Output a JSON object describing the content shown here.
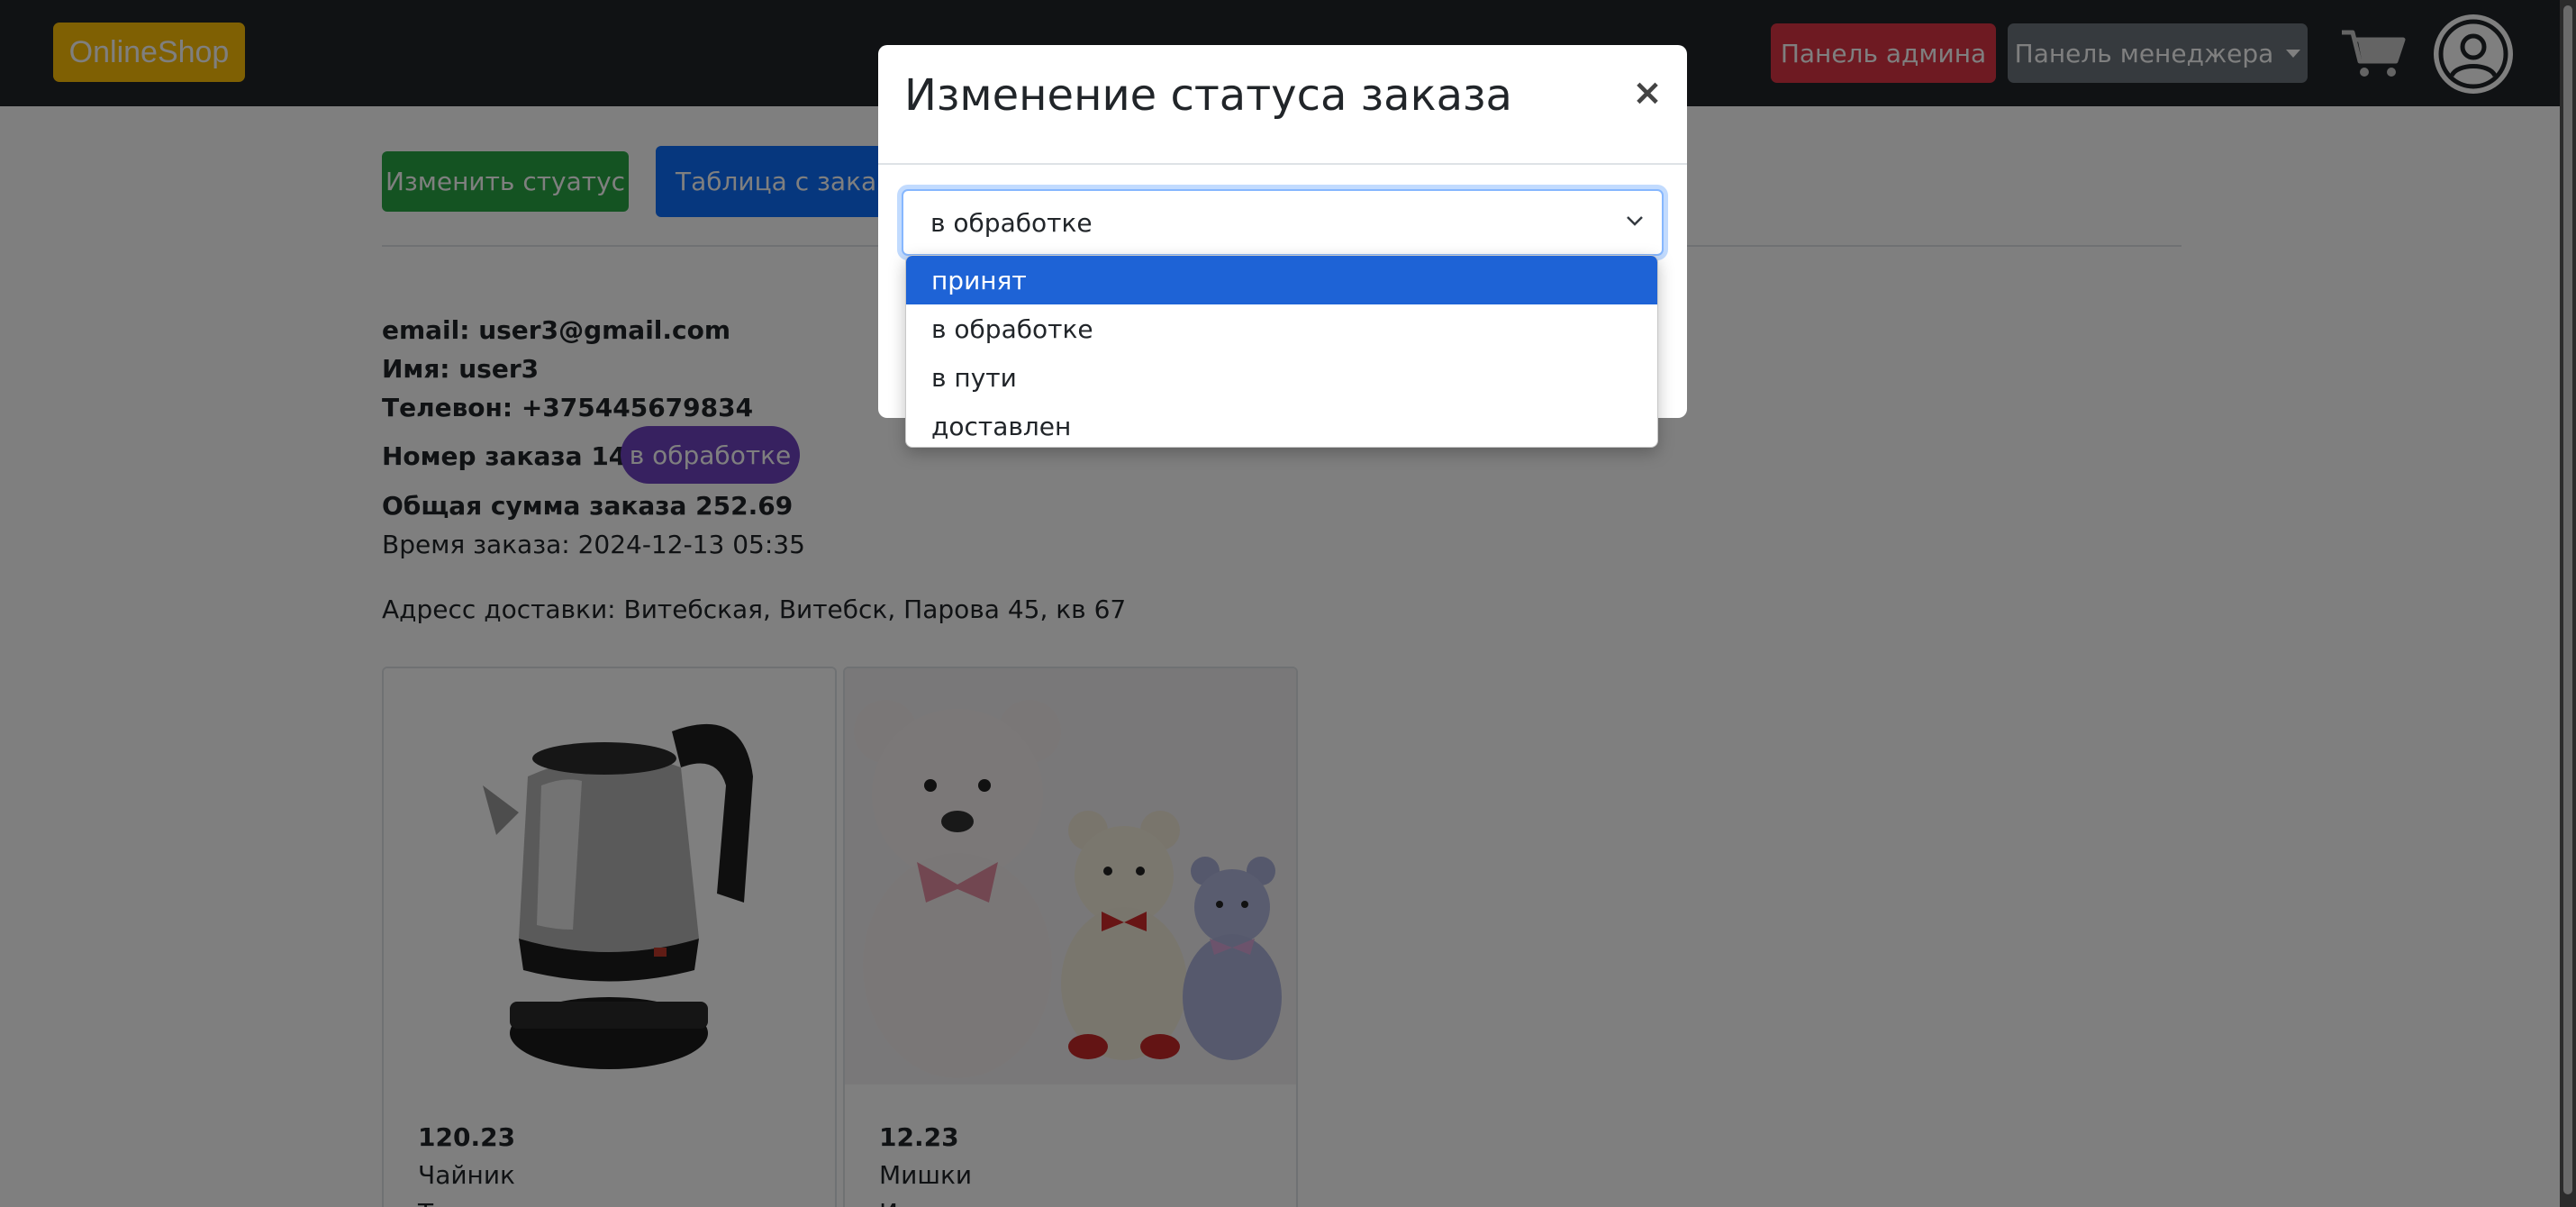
{
  "navbar": {
    "brand": "OnlineShop",
    "admin_panel": "Панель админа",
    "manager_panel": "Панель менеджера"
  },
  "actions": {
    "change_status": "Изменить стуатус",
    "orders_table": "Таблица с заказами"
  },
  "order": {
    "email": "email: user3@gmail.com",
    "name": "Имя: user3",
    "phone": "Телевон: +375445679834",
    "number": "Номер заказа 145",
    "status_badge": "в обработке",
    "total": "Общая сумма заказа 252.69",
    "time": "Время заказа: 2024-12-13 05:35",
    "address": "Адресс доставки: Витебская, Витебск, Парова 45, кв 67"
  },
  "products": [
    {
      "price": "120.23",
      "name": "Чайник",
      "desc": "Т"
    },
    {
      "price": "12.23",
      "name": "Мишки",
      "desc": "И"
    }
  ],
  "modal": {
    "title": "Изменение статуса заказа",
    "close": "×",
    "select_value": "в обработке",
    "options": [
      "принят",
      "в обработке",
      "в пути",
      "доставлен"
    ],
    "highlighted_option": "принят"
  },
  "colors": {
    "navbar": "#212529",
    "brand": "#ffc107",
    "admin": "#dc3545",
    "manager": "#6c757d",
    "change_status": "#28a745",
    "orders_table": "#0d6efd",
    "badge": "#6f42c1",
    "option_highlight": "#1e63d6"
  }
}
